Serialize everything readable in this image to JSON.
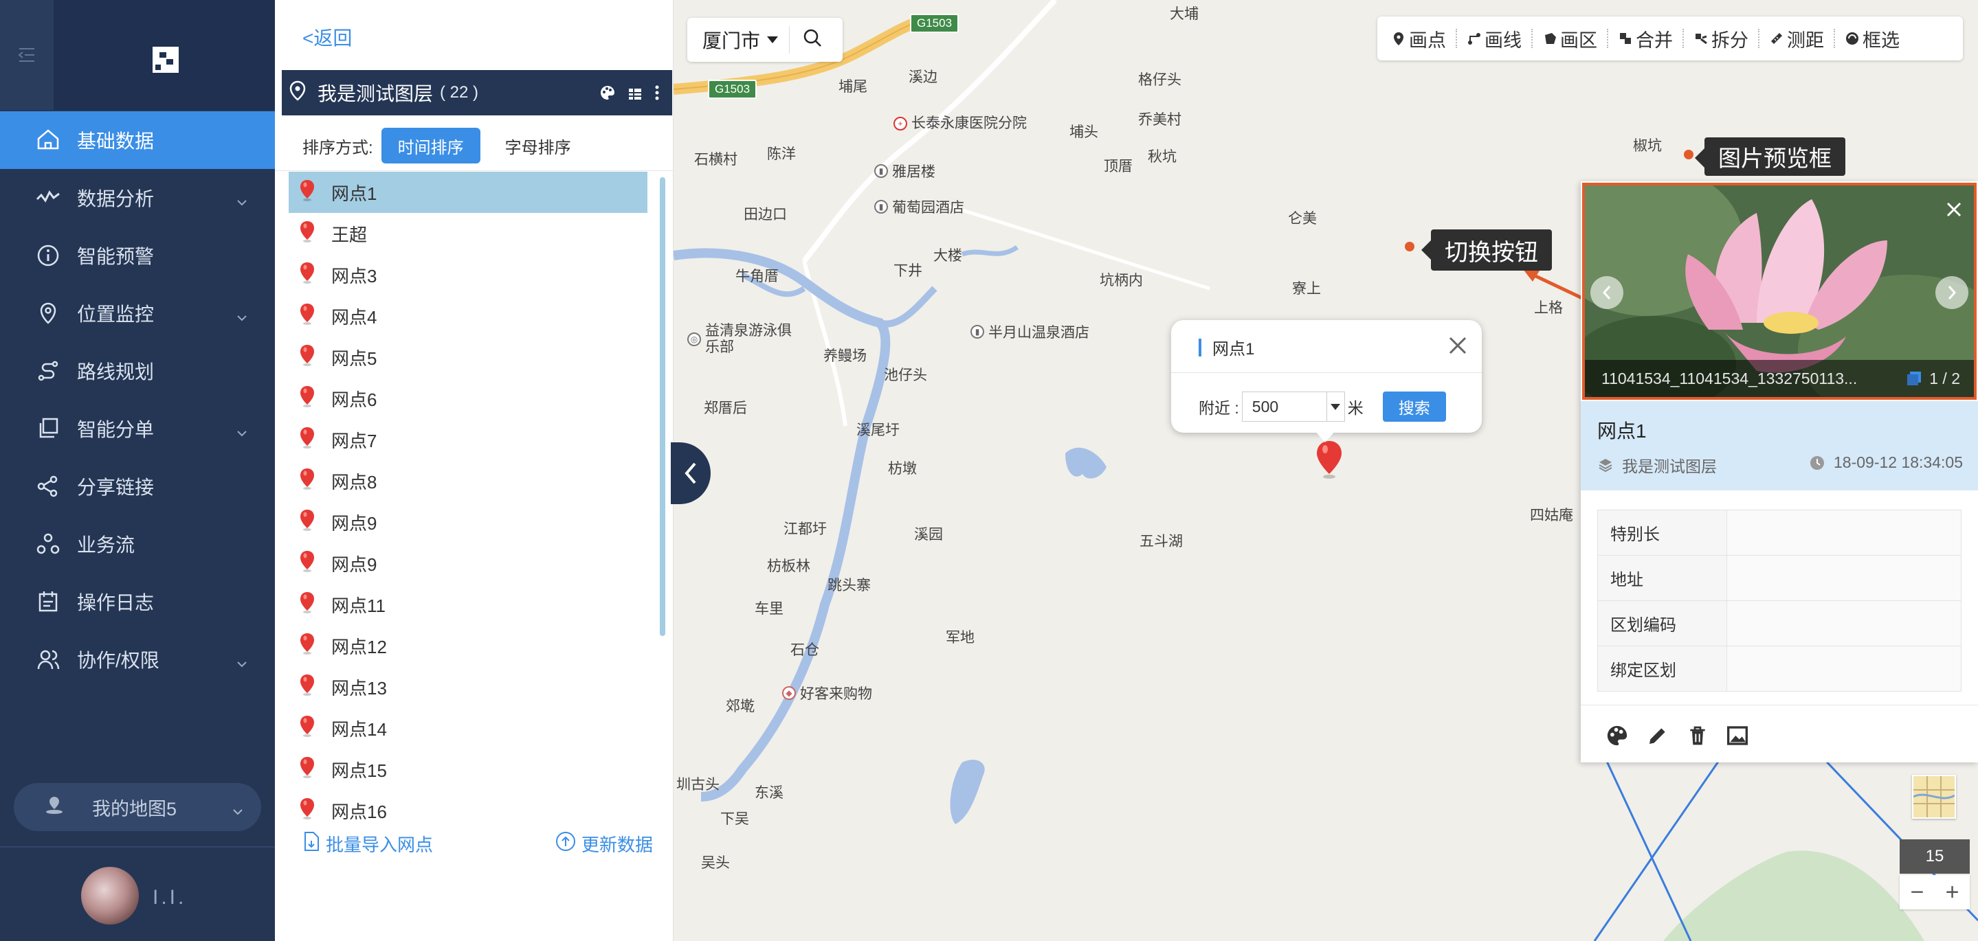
{
  "nav": {
    "items": [
      {
        "label": "基础数据",
        "icon": "home-icon",
        "active": true,
        "has_sub": false
      },
      {
        "label": "数据分析",
        "icon": "pulse-icon",
        "active": false,
        "has_sub": true
      },
      {
        "label": "智能预警",
        "icon": "info-icon",
        "active": false,
        "has_sub": false
      },
      {
        "label": "位置监控",
        "icon": "location-icon",
        "active": false,
        "has_sub": true
      },
      {
        "label": "路线规划",
        "icon": "route-icon",
        "active": false,
        "has_sub": false
      },
      {
        "label": "智能分单",
        "icon": "copy-icon",
        "active": false,
        "has_sub": true
      },
      {
        "label": "分享链接",
        "icon": "share-icon",
        "active": false,
        "has_sub": false
      },
      {
        "label": "业务流",
        "icon": "workflow-icon",
        "active": false,
        "has_sub": false
      },
      {
        "label": "操作日志",
        "icon": "calendar-icon",
        "active": false,
        "has_sub": false
      },
      {
        "label": "协作/权限",
        "icon": "users-icon",
        "active": false,
        "has_sub": true
      }
    ],
    "my_map": "我的地图5",
    "username": "I.I."
  },
  "panel": {
    "back": "<返回",
    "layer_name": "我是测试图层",
    "layer_count": "( 22 )",
    "sort_label": "排序方式:",
    "sort_time": "时间排序",
    "sort_alpha": "字母排序",
    "points": [
      "网点1",
      "王超",
      "网点3",
      "网点4",
      "网点5",
      "网点6",
      "网点7",
      "网点8",
      "网点9",
      "网点9",
      "网点11",
      "网点12",
      "网点13",
      "网点14",
      "网点15",
      "网点16"
    ],
    "selected_index": 0,
    "import_label": "批量导入网点",
    "refresh_label": "更新数据"
  },
  "map": {
    "city": "厦门市",
    "toolbar": [
      {
        "label": "画点",
        "icon": "map-pin-icon"
      },
      {
        "label": "画线",
        "icon": "draw-line-icon"
      },
      {
        "label": "画区",
        "icon": "draw-area-icon"
      },
      {
        "label": "合并",
        "icon": "merge-icon"
      },
      {
        "label": "拆分",
        "icon": "split-icon"
      },
      {
        "label": "测距",
        "icon": "ruler-icon"
      },
      {
        "label": "框选",
        "icon": "lasso-icon"
      }
    ],
    "road_badges": [
      "G1503",
      "G1503"
    ],
    "places": [
      "大埔",
      "埔尾",
      "溪边",
      "格仔头",
      "乔美村",
      "埔头",
      "顶厝",
      "秋坑",
      "石横村",
      "陈洋",
      "田边口",
      "仑美",
      "牛角厝",
      "下井",
      "大楼",
      "坑柄内",
      "寮上",
      "上格",
      "养鳗场",
      "池仔头",
      "郑厝后",
      "溪尾圩",
      "枋墩",
      "江都圩",
      "溪园",
      "枋板林",
      "跳头寨",
      "五斗湖",
      "四姑庵",
      "车里",
      "石仓",
      "军地",
      "郊墘",
      "圳古头",
      "东溪",
      "下吴",
      "吴头",
      "椒坑"
    ],
    "pois": [
      "长泰永康医院分院",
      "雅居楼",
      "葡萄园酒店",
      "益清泉游泳俱乐部",
      "半月山温泉酒店",
      "好客来购物"
    ],
    "zoom": "15"
  },
  "popup": {
    "title": "网点1",
    "near_label": "附近 :",
    "near_value": "500",
    "unit": "米",
    "search": "搜索"
  },
  "annotations": {
    "preview": "图片预览框",
    "toggle": "切换按钮",
    "accent": "#e25b2b"
  },
  "card": {
    "caption": "11041534_11041534_1332750113...",
    "page": "1 / 2",
    "name": "网点1",
    "layer": "我是测试图层",
    "time": "18-09-12 18:34:05",
    "fields": [
      {
        "key": "特别长",
        "value": ""
      },
      {
        "key": "地址",
        "value": ""
      },
      {
        "key": "区划编码",
        "value": ""
      },
      {
        "key": "绑定区划",
        "value": ""
      }
    ]
  },
  "colors": {
    "primary": "#3a8ee6",
    "nav_bg": "#243654",
    "marker": "#e53935"
  }
}
